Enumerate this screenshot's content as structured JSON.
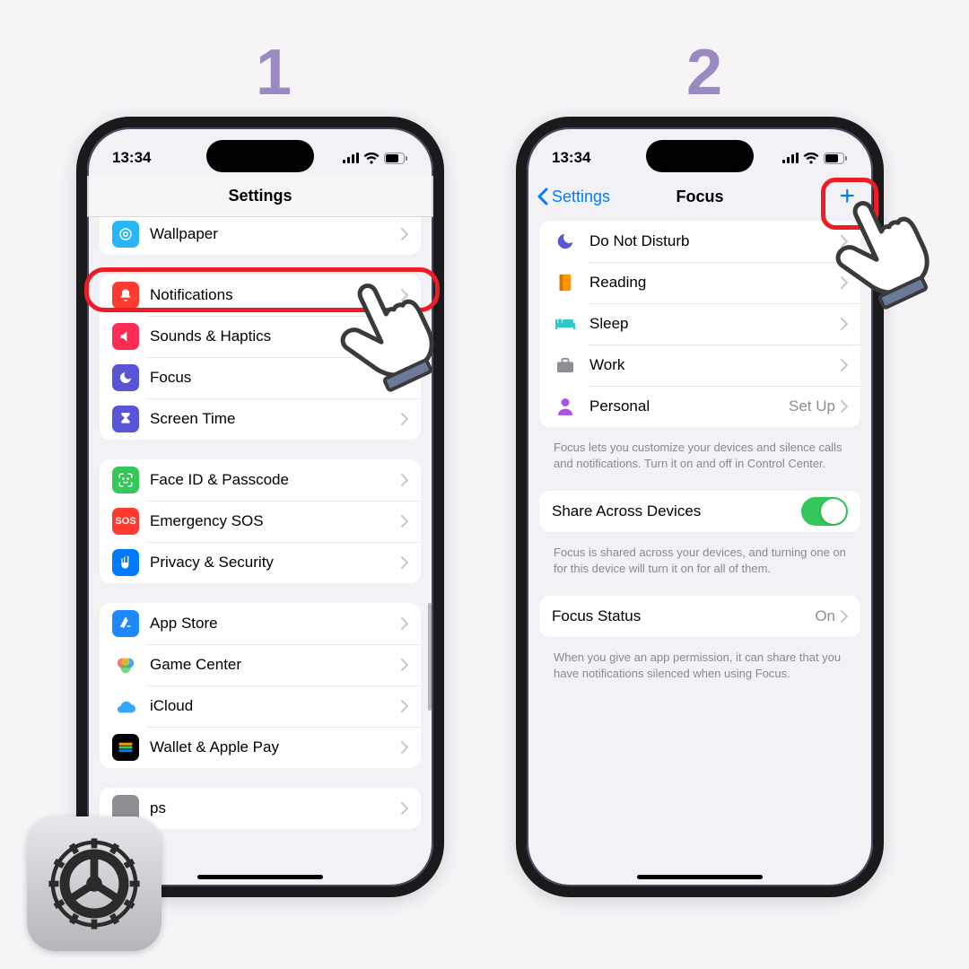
{
  "steps": {
    "one": "1",
    "two": "2"
  },
  "status": {
    "time": "13:34"
  },
  "phone1": {
    "title": "Settings",
    "groups": [
      [
        {
          "icon": "wallpaper",
          "label": "Wallpaper"
        }
      ],
      [
        {
          "icon": "notifications",
          "label": "Notifications"
        },
        {
          "icon": "sounds",
          "label": "Sounds & Haptics"
        },
        {
          "icon": "focus",
          "label": "Focus"
        },
        {
          "icon": "screentime",
          "label": "Screen Time"
        }
      ],
      [
        {
          "icon": "faceid",
          "label": "Face ID & Passcode"
        },
        {
          "icon": "sos",
          "label": "Emergency SOS"
        },
        {
          "icon": "privacy",
          "label": "Privacy & Security"
        }
      ],
      [
        {
          "icon": "appstore",
          "label": "App Store"
        },
        {
          "icon": "gamecenter",
          "label": "Game Center"
        },
        {
          "icon": "icloud",
          "label": "iCloud"
        },
        {
          "icon": "wallet",
          "label": "Wallet & Apple Pay"
        }
      ],
      [
        {
          "icon": "generic",
          "label": "ps"
        }
      ]
    ]
  },
  "phone2": {
    "back": "Settings",
    "title": "Focus",
    "modes": [
      {
        "icon": "moon",
        "color": "#5856d6",
        "label": "Do Not Disturb"
      },
      {
        "icon": "book",
        "color": "#ff9500",
        "label": "Reading"
      },
      {
        "icon": "bed",
        "color": "#30c8c9",
        "label": "Sleep"
      },
      {
        "icon": "case",
        "color": "#8e8e93",
        "label": "Work"
      },
      {
        "icon": "person",
        "color": "#af52de",
        "label": "Personal",
        "detail": "Set Up"
      }
    ],
    "footer1": "Focus lets you customize your devices and silence calls and notifications. Turn it on and off in Control Center.",
    "share": {
      "label": "Share Across Devices"
    },
    "footer2": "Focus is shared across your devices, and turning one on for this device will turn it on for all of them.",
    "status": {
      "label": "Focus Status",
      "value": "On"
    },
    "footer3": "When you give an app permission, it can share that you have notifications silenced when using Focus."
  }
}
